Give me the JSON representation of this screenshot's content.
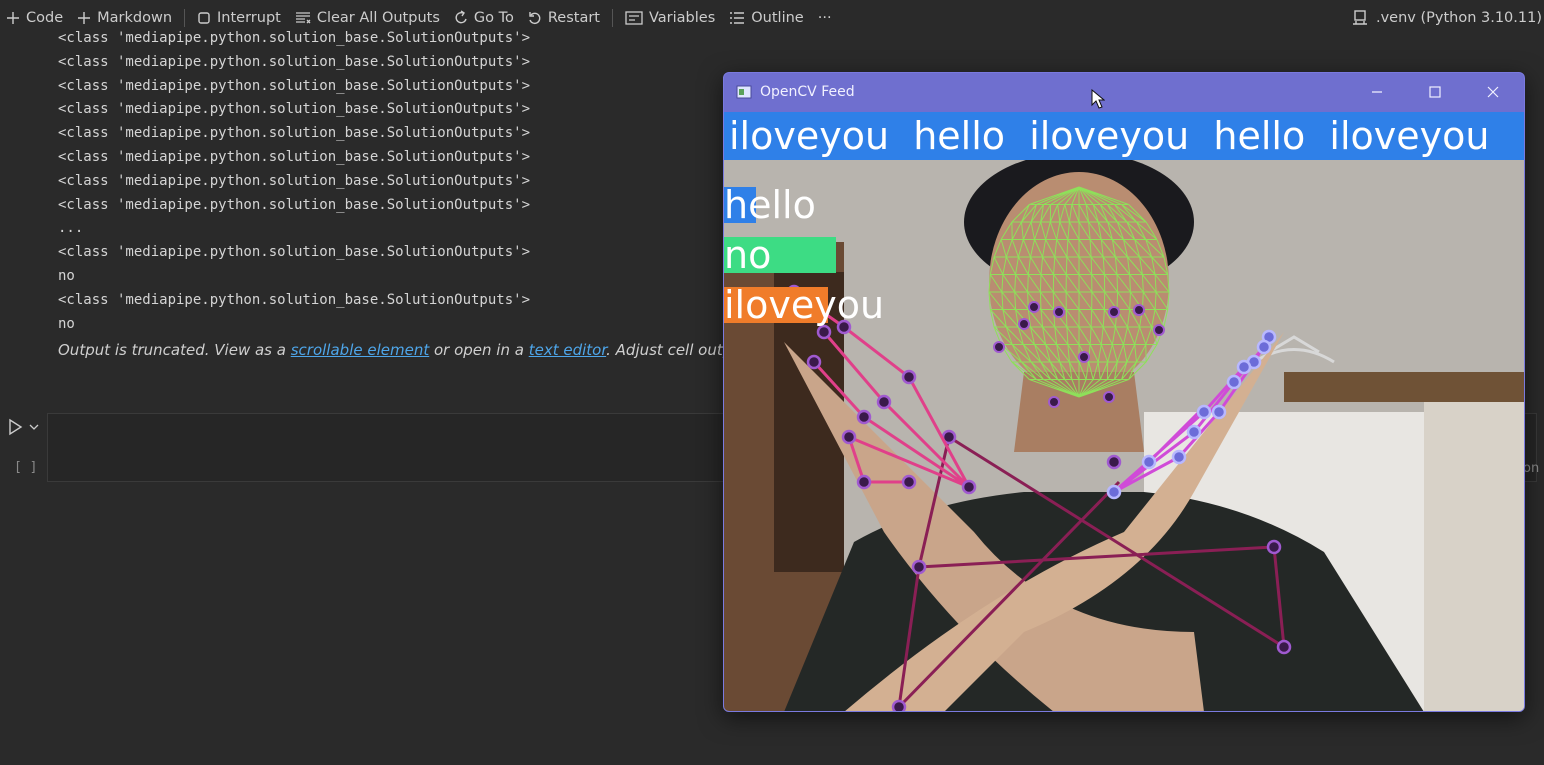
{
  "toolbar": {
    "code": "Code",
    "markdown": "Markdown",
    "interrupt": "Interrupt",
    "clear_all_outputs": "Clear All Outputs",
    "go_to": "Go To",
    "restart": "Restart",
    "variables": "Variables",
    "outline": "Outline",
    "more": "···",
    "kernel": ".venv (Python 3.10.11)"
  },
  "output": {
    "lines": [
      "<class 'mediapipe.python.solution_base.SolutionOutputs'>",
      "<class 'mediapipe.python.solution_base.SolutionOutputs'>",
      "<class 'mediapipe.python.solution_base.SolutionOutputs'>",
      "<class 'mediapipe.python.solution_base.SolutionOutputs'>",
      "<class 'mediapipe.python.solution_base.SolutionOutputs'>",
      "<class 'mediapipe.python.solution_base.SolutionOutputs'>",
      "<class 'mediapipe.python.solution_base.SolutionOutputs'>",
      "<class 'mediapipe.python.solution_base.SolutionOutputs'>",
      "...",
      "<class 'mediapipe.python.solution_base.SolutionOutputs'>",
      "no",
      "<class 'mediapipe.python.solution_base.SolutionOutputs'>",
      "no"
    ],
    "truncated_prefix": "Output is truncated. View as a ",
    "scrollable_link": "scrollable element",
    "truncated_middle": " or open in a ",
    "editor_link": "text editor",
    "truncated_suffix": ". Adjust cell output settings..."
  },
  "cell": {
    "execution_count": "[ ]",
    "edge_text": "on"
  },
  "cv_window": {
    "title": "OpenCV Feed",
    "sentence": "iloveyou  hello  iloveyou  hello  iloveyou",
    "sentence_bar_color": "#2f80e8",
    "actions": [
      {
        "label": "hello",
        "probability": 0.04,
        "color": "#2f80e8"
      },
      {
        "label": "no",
        "probability": 0.14,
        "color": "#3ddc84"
      },
      {
        "label": "iloveyou",
        "probability": 0.13,
        "color": "#f07c2a"
      }
    ]
  },
  "colors": {
    "background": "#2a2a2a",
    "link": "#4ea6ea",
    "titlebar": "#6f6fcf",
    "face_mesh": "#8ee05a",
    "pose_lines": "#8a1f55",
    "left_hand": "#e0408a",
    "right_hand": "#d04bd8"
  }
}
